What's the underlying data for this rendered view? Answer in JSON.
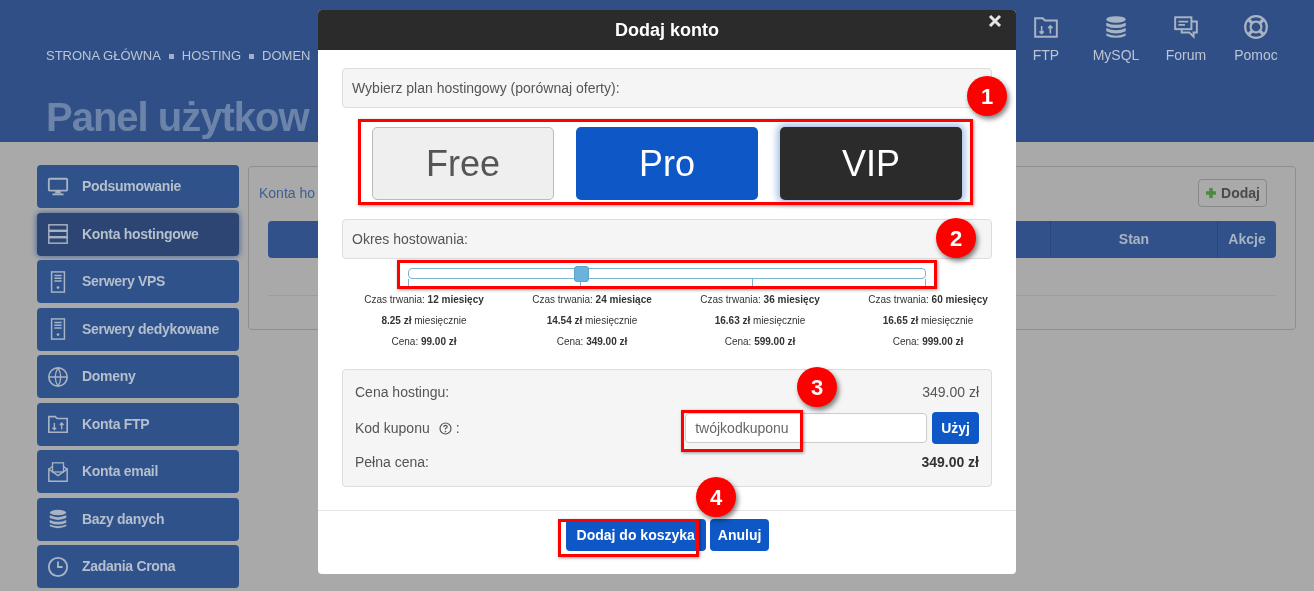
{
  "header": {
    "nav": [
      "STRONA GŁÓWNA",
      "HOSTING",
      "DOMEN"
    ],
    "shortcuts": [
      {
        "kind": "ftp",
        "label": "FTP"
      },
      {
        "kind": "database",
        "label": "MySQL"
      },
      {
        "kind": "forum",
        "label": "Forum"
      },
      {
        "kind": "help",
        "label": "Pomoc"
      }
    ],
    "title": "Panel użytkow"
  },
  "sidebar": {
    "items": [
      {
        "kind": "monitor",
        "label": "Podsumowanie",
        "selected": false
      },
      {
        "kind": "servers",
        "label": "Konta hostingowe",
        "selected": true
      },
      {
        "kind": "tower",
        "label": "Serwery VPS",
        "selected": false
      },
      {
        "kind": "tower",
        "label": "Serwery dedykowane",
        "selected": false
      },
      {
        "kind": "globe",
        "label": "Domeny",
        "selected": false
      },
      {
        "kind": "ftp",
        "label": "Konta FTP",
        "selected": false
      },
      {
        "kind": "email",
        "label": "Konta email",
        "selected": false
      },
      {
        "kind": "database",
        "label": "Bazy danych",
        "selected": false
      },
      {
        "kind": "clock",
        "label": "Zadania Crona",
        "selected": false
      }
    ]
  },
  "content": {
    "title": "Konta ho",
    "add_button": "Dodaj",
    "table": {
      "columns": [
        "Stan",
        "Akcje"
      ]
    }
  },
  "dialog": {
    "title": "Dodaj konto",
    "plan_label": "Wybierz plan hostingowy (porównaj oferty):",
    "plans": [
      {
        "kind": "free",
        "label": "Free",
        "selected": false
      },
      {
        "kind": "pro",
        "label": "Pro",
        "selected": false
      },
      {
        "kind": "vip",
        "label": "VIP",
        "selected": true
      }
    ],
    "period_label": "Okres hostowania:",
    "slider": {
      "level": 0.333
    },
    "periods": [
      {
        "duration": "Czas trwania: **12 miesięcy**",
        "monthly": "**8.25 zł** miesięcznie",
        "price": "Cena: **99.00 zł**"
      },
      {
        "duration": "Czas trwania: **24 miesiące**",
        "monthly": "**14.54 zł** miesięcznie",
        "price": "Cena: **349.00 zł**"
      },
      {
        "duration": "Czas trwania: **36 miesięcy**",
        "monthly": "**16.63 zł** miesięcznie",
        "price": "Cena: **599.00 zł**"
      },
      {
        "duration": "Czas trwania: **60 miesięcy**",
        "monthly": "**16.65 zł** miesięcznie",
        "price": "Cena: **999.00 zł**"
      }
    ],
    "summary": {
      "hosting_price_label": "Cena hostingu:",
      "hosting_price": "349.00 zł",
      "coupon_label": "Kod kuponu",
      "coupon_suffix": ":",
      "coupon_placeholder": "twójkodkuponu",
      "apply_button": "Użyj",
      "total_label": "Pełna cena:",
      "total": "349.00 zł"
    },
    "buttons": [
      "Dodaj do koszyka",
      "Anuluj"
    ]
  },
  "annotations": [
    "1",
    "2",
    "3",
    "4"
  ]
}
